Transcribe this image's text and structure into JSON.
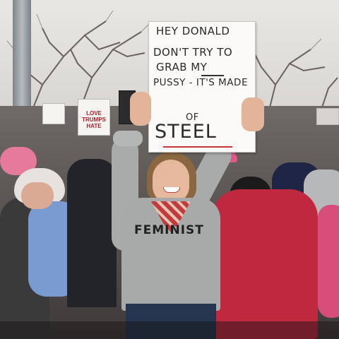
{
  "photo": {
    "main_sign": {
      "lines": [
        "HEY DONALD",
        "DON'T TRY TO",
        "GRAB MY",
        "PUSSY - IT'S MADE",
        "OF",
        "STEEL"
      ]
    },
    "shirt_text": "FEMINIST",
    "background_sign_left": "LOVE\nTRUMPS\nHATE",
    "colors": {
      "sky": "#e6e4e1",
      "sweater": "#a8aaa9",
      "pink_coat": "#c0283f",
      "sign_paper": "#fbfaf8",
      "sign_ink": "#2a2a2a"
    }
  }
}
